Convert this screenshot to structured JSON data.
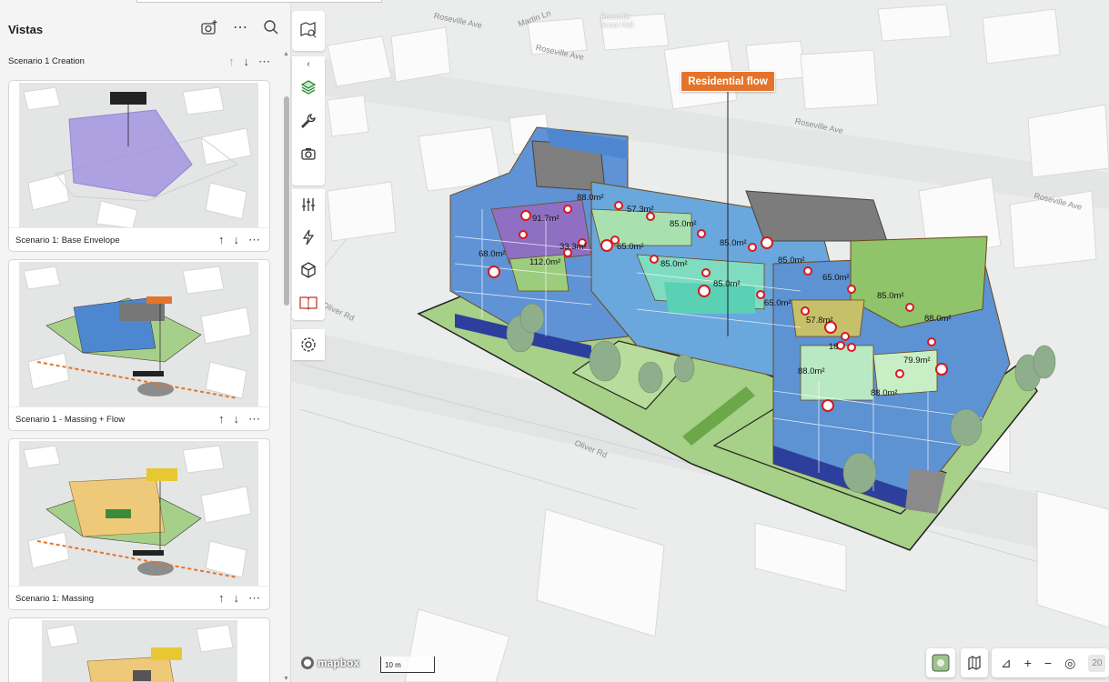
{
  "sidebar": {
    "title": "Vistas",
    "header_icons": [
      "camera-plus-icon",
      "more-icon",
      "search-icon"
    ],
    "rows": [
      {
        "label": "Scenario 1 Creation"
      }
    ],
    "cards": [
      {
        "label": "Scenario 1: Base Envelope"
      },
      {
        "label": "Scenario 1 - Massing + Flow"
      },
      {
        "label": "Scenario 1: Massing"
      }
    ]
  },
  "toolbar": {
    "items": [
      "map-search-icon",
      "collapse-chevron-icon",
      "layers-icon",
      "wrench-icon",
      "camera-icon",
      "sliders-icon",
      "lightning-icon",
      "cube-icon",
      "book-icon",
      "settings-icon"
    ]
  },
  "map": {
    "callout": "Residential flow",
    "streets": [
      "Roseville Ave",
      "Martin Ln",
      "Roseville Ave",
      "Roseville Ave",
      "Roseville Ave",
      "Oliver Rd",
      "Oliver Rd"
    ],
    "poi": "Roseville\nScout Hall",
    "areas": [
      "88.0m²",
      "57.3m²",
      "91.7m²",
      "85.0m²",
      "85.0m²",
      "33.3m²",
      "65.0m²",
      "68.0m²",
      "112.0m²",
      "85.0m²",
      "85.0m²",
      "65.0m²",
      "85.0m²",
      "85.0m²",
      "65.0m²",
      "88.0m²",
      "57.8m²",
      "18",
      "79.9m²",
      "88.0m²",
      "88.0m²"
    ],
    "attribution": "mapbox",
    "scale": "10 m"
  },
  "controls": {
    "icons": [
      "satellite-toggle-icon",
      "map-style-icon",
      "pitch-icon",
      "zoom-in-icon",
      "zoom-out-icon",
      "locate-icon"
    ],
    "zoom_partial": "20"
  }
}
